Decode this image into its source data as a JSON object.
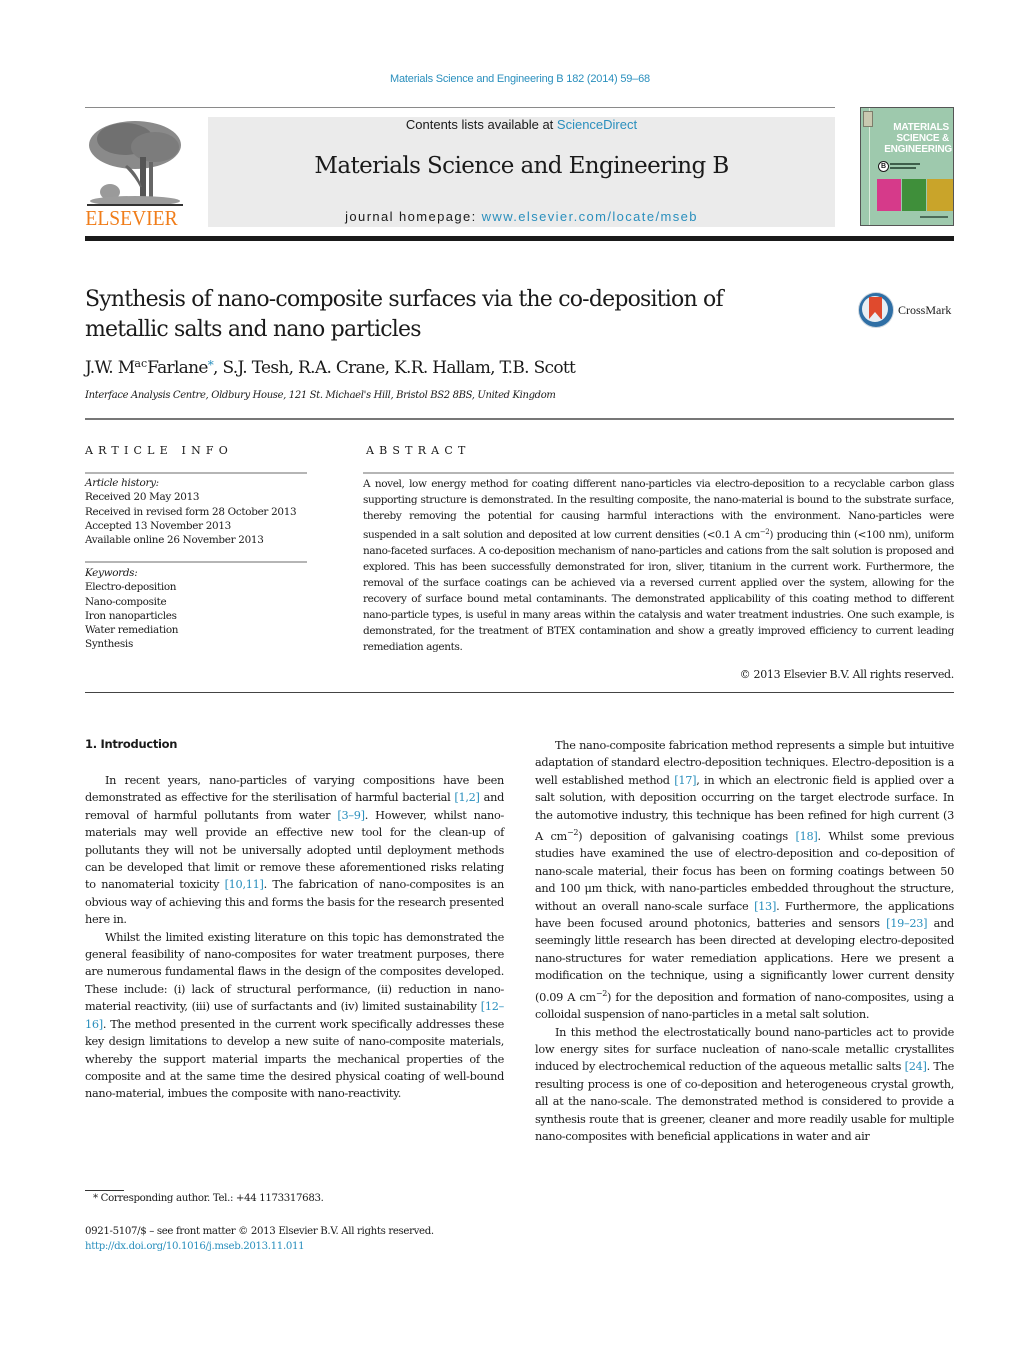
{
  "header": {
    "citation": "Materials Science and Engineering B 182 (2014) 59–68",
    "contents_prefix": "Contents lists available at ",
    "contents_link": "ScienceDirect",
    "journal_title": "Materials Science and Engineering B",
    "homepage_prefix": "journal homepage: ",
    "homepage_link": "www.elsevier.com/locate/mseb",
    "publisher_logo_text": "ELSEVIER",
    "cover": {
      "line1": "MATERIALS",
      "line2": "SCIENCE &",
      "line3": "ENGINEERING",
      "badge": "B",
      "background_color": "#9ec9ad",
      "image_colors": [
        "#d63a8a",
        "#3f8f3a",
        "#c9a42a"
      ]
    },
    "brand_color": "#f07d1a",
    "link_color": "#2a8fbd"
  },
  "article": {
    "title_line1": "Synthesis of nano-composite surfaces via the co-deposition of",
    "title_line2": "metallic salts and nano particles",
    "crossmark_label": "CrossMark",
    "authors_first_prefix": "J.W. M",
    "authors_first_sup": "ac",
    "authors_first_suffix": "Farlane",
    "corresponding_marker": "*",
    "authors_rest": ", S.J. Tesh, R.A. Crane, K.R. Hallam, T.B. Scott",
    "affiliation": "Interface Analysis Centre, Oldbury House, 121 St. Michael's Hill, Bristol BS2 8BS, United Kingdom"
  },
  "article_info": {
    "label": "ARTICLE INFO",
    "history_label": "Article history:",
    "history": [
      "Received 20 May 2013",
      "Received in revised form 28 October 2013",
      "Accepted 13 November 2013",
      "Available online 26 November 2013"
    ],
    "keywords_label": "Keywords:",
    "keywords": [
      "Electro-deposition",
      "Nano-composite",
      "Iron nanoparticles",
      "Water remediation",
      "Synthesis"
    ]
  },
  "abstract": {
    "label": "ABSTRACT",
    "part1": "A novel, low energy method for coating different nano-particles via electro-deposition to a recyclable carbon glass supporting structure is demonstrated. In the resulting composite, the nano-material is bound to the substrate surface, thereby removing the potential for causing harmful interactions with the environment. Nano-particles were suspended in a salt solution and deposited at low current densities (<0.1 A cm",
    "part1_sup": "−2",
    "part2": ") producing thin (<100 nm), uniform nano-faceted surfaces. A co-deposition mechanism of nano-particles and cations from the salt solution is proposed and explored. This has been successfully demonstrated for iron, sliver, titanium in the current work. Furthermore, the removal of the surface coatings can be achieved via a reversed current applied over the system, allowing for the recovery of surface bound metal contaminants. The demonstrated applicability of this coating method to different nano-particle types, is useful in many areas within the catalysis and water treatment industries. One such example, is demonstrated, for the treatment of BTEX contamination and show a greatly improved efficiency to current leading remediation agents.",
    "copyright": "© 2013 Elsevier B.V. All rights reserved."
  },
  "body": {
    "section_heading": "1.  Introduction",
    "left": {
      "p1_a": "In recent years, nano-particles of varying compositions have been demonstrated as effective for the sterilisation of harmful bacterial ",
      "p1_ref1": "[1,2]",
      "p1_b": " and removal of harmful pollutants from water ",
      "p1_ref2": "[3–9]",
      "p1_c": ". However, whilst nano-materials may well provide an effective new tool for the clean-up of pollutants they will not be universally adopted until deployment methods can be developed that limit or remove these aforementioned risks relating to nanomaterial toxicity ",
      "p1_ref3": "[10,11]",
      "p1_d": ". The fabrication of nano-composites is an obvious way of achieving this and forms the basis for the research presented here in.",
      "p2_a": "Whilst the limited existing literature on this topic has demonstrated the general feasibility of nano-composites for water treatment purposes, there are numerous fundamental flaws in the design of the composites developed. These include: (i) lack of structural performance, (ii) reduction in nano-material reactivity, (iii) use of surfactants and (iv) limited sustainability ",
      "p2_ref1": "[12–16]",
      "p2_b": ". The method presented in the current work specifically addresses these key design limitations to develop a new suite of nano-composite materials, whereby the support material imparts the mechanical properties of the composite and at the same time the desired physical coating of well-bound nano-material, imbues the composite with nano-reactivity."
    },
    "right": {
      "p1_a": "The nano-composite fabrication method represents a simple but intuitive adaptation of standard electro-deposition techniques. Electro-deposition is a well established method ",
      "p1_ref1": "[17]",
      "p1_b": ", in which an electronic field is applied over a salt solution, with deposition occurring on the target electrode surface. In the automotive industry, this technique has been refined for high current (3 A cm",
      "p1_sup1": "−2",
      "p1_c": ") deposition of galvanising coatings ",
      "p1_ref2": "[18]",
      "p1_d": ". Whilst some previous studies have examined the use of electro-deposition and co-deposition of nano-scale material, their focus has been on forming coatings between 50 and 100 μm thick, with nano-particles embedded throughout the structure, without an overall nano-scale surface ",
      "p1_ref3": "[13]",
      "p1_e": ". Furthermore, the applications have been focused around photonics, batteries and sensors ",
      "p1_ref4": "[19–23]",
      "p1_f": " and seemingly little research has been directed at developing electro-deposited nano-structures for water remediation applications. Here we present a modification on the technique, using a significantly lower current density (0.09 A cm",
      "p1_sup2": "−2",
      "p1_g": ") for the deposition and formation of nano-composites, using a colloidal suspension of nano-particles in a metal salt solution.",
      "p2_a": "In this method the electrostatically bound nano-particles act to provide low energy sites for surface nucleation of nano-scale metallic crystallites induced by electrochemical reduction of the aqueous metallic salts ",
      "p2_ref1": "[24]",
      "p2_b": ". The resulting process is one of co-deposition and heterogeneous crystal growth, all at the nano-scale. The demonstrated method is considered to provide a synthesis route that is greener, cleaner and more readily usable for multiple nano-composites with beneficial applications in water and air"
    }
  },
  "footer": {
    "footnote": "*  Corresponding author. Tel.: +44 1173317683.",
    "issn_line": "0921-5107/$ – see front matter © 2013 Elsevier B.V. All rights reserved.",
    "doi_link": "http://dx.doi.org/10.1016/j.mseb.2013.11.011"
  }
}
